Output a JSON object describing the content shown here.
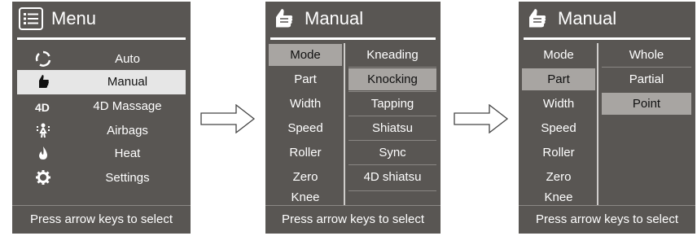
{
  "menu": {
    "title": "Menu",
    "items": [
      {
        "label": "Auto",
        "icon": "auto-cycle-icon"
      },
      {
        "label": "Manual",
        "icon": "hand-thumbs-up-icon",
        "selected": true
      },
      {
        "label": "4D Massage",
        "icon": "4d-icon",
        "icon_text": "4D"
      },
      {
        "label": "Airbags",
        "icon": "airbags-figure-icon"
      },
      {
        "label": "Heat",
        "icon": "flame-icon"
      },
      {
        "label": "Settings",
        "icon": "gear-icon"
      }
    ],
    "footer": "Press arrow keys to select"
  },
  "manual_mode": {
    "title": "Manual",
    "left_items": [
      "Mode",
      "Part",
      "Width",
      "Speed",
      "Roller",
      "Zero",
      "Knee"
    ],
    "left_selected": "Mode",
    "right_items": [
      "Kneading",
      "Knocking",
      "Tapping",
      "Shiatsu",
      "Sync",
      "4D shiatsu"
    ],
    "right_selected": "Knocking",
    "footer": "Press arrow keys to select"
  },
  "manual_part": {
    "title": "Manual",
    "left_items": [
      "Mode",
      "Part",
      "Width",
      "Speed",
      "Roller",
      "Zero",
      "Knee"
    ],
    "left_selected": "Part",
    "right_items": [
      "Whole",
      "Partial",
      "Point"
    ],
    "right_selected": "Point",
    "footer": "Press arrow keys to select"
  },
  "colors": {
    "screen_bg": "#595653",
    "menu_selection": "#e6e6e6",
    "highlight": "#a8a5a2",
    "text": "#ffffff"
  }
}
